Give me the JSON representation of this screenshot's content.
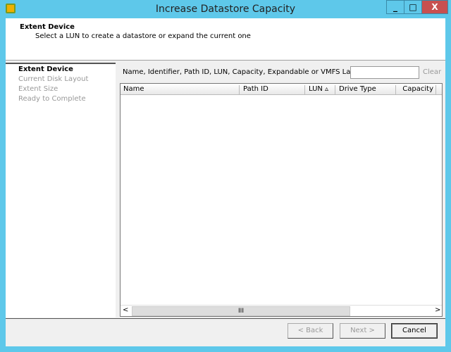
{
  "window": {
    "title": "Increase Datastore Capacity",
    "controls": {
      "minimize": "_",
      "maximize": "□",
      "close": "X"
    }
  },
  "header": {
    "title": "Extent Device",
    "subtitle": "Select a LUN to create a datastore or expand the current one"
  },
  "steps": [
    {
      "label": "Extent Device",
      "active": true
    },
    {
      "label": "Current Disk Layout"
    },
    {
      "label": "Extent Size"
    },
    {
      "label": "Ready to Complete"
    }
  ],
  "filter": {
    "label": "Name, Identifier, Path ID, LUN, Capacity, Expandable or VMFS Label c... ▾",
    "value": "",
    "clear": "Clear"
  },
  "table": {
    "columns": [
      "Name",
      "Path ID",
      "LUN ▵",
      "Drive Type",
      "Capacity"
    ],
    "rows": [],
    "scroll_left": "<",
    "scroll_right": ">",
    "scroll_grip": "III"
  },
  "buttons": {
    "back": "< Back",
    "next": "Next >",
    "cancel": "Cancel"
  }
}
